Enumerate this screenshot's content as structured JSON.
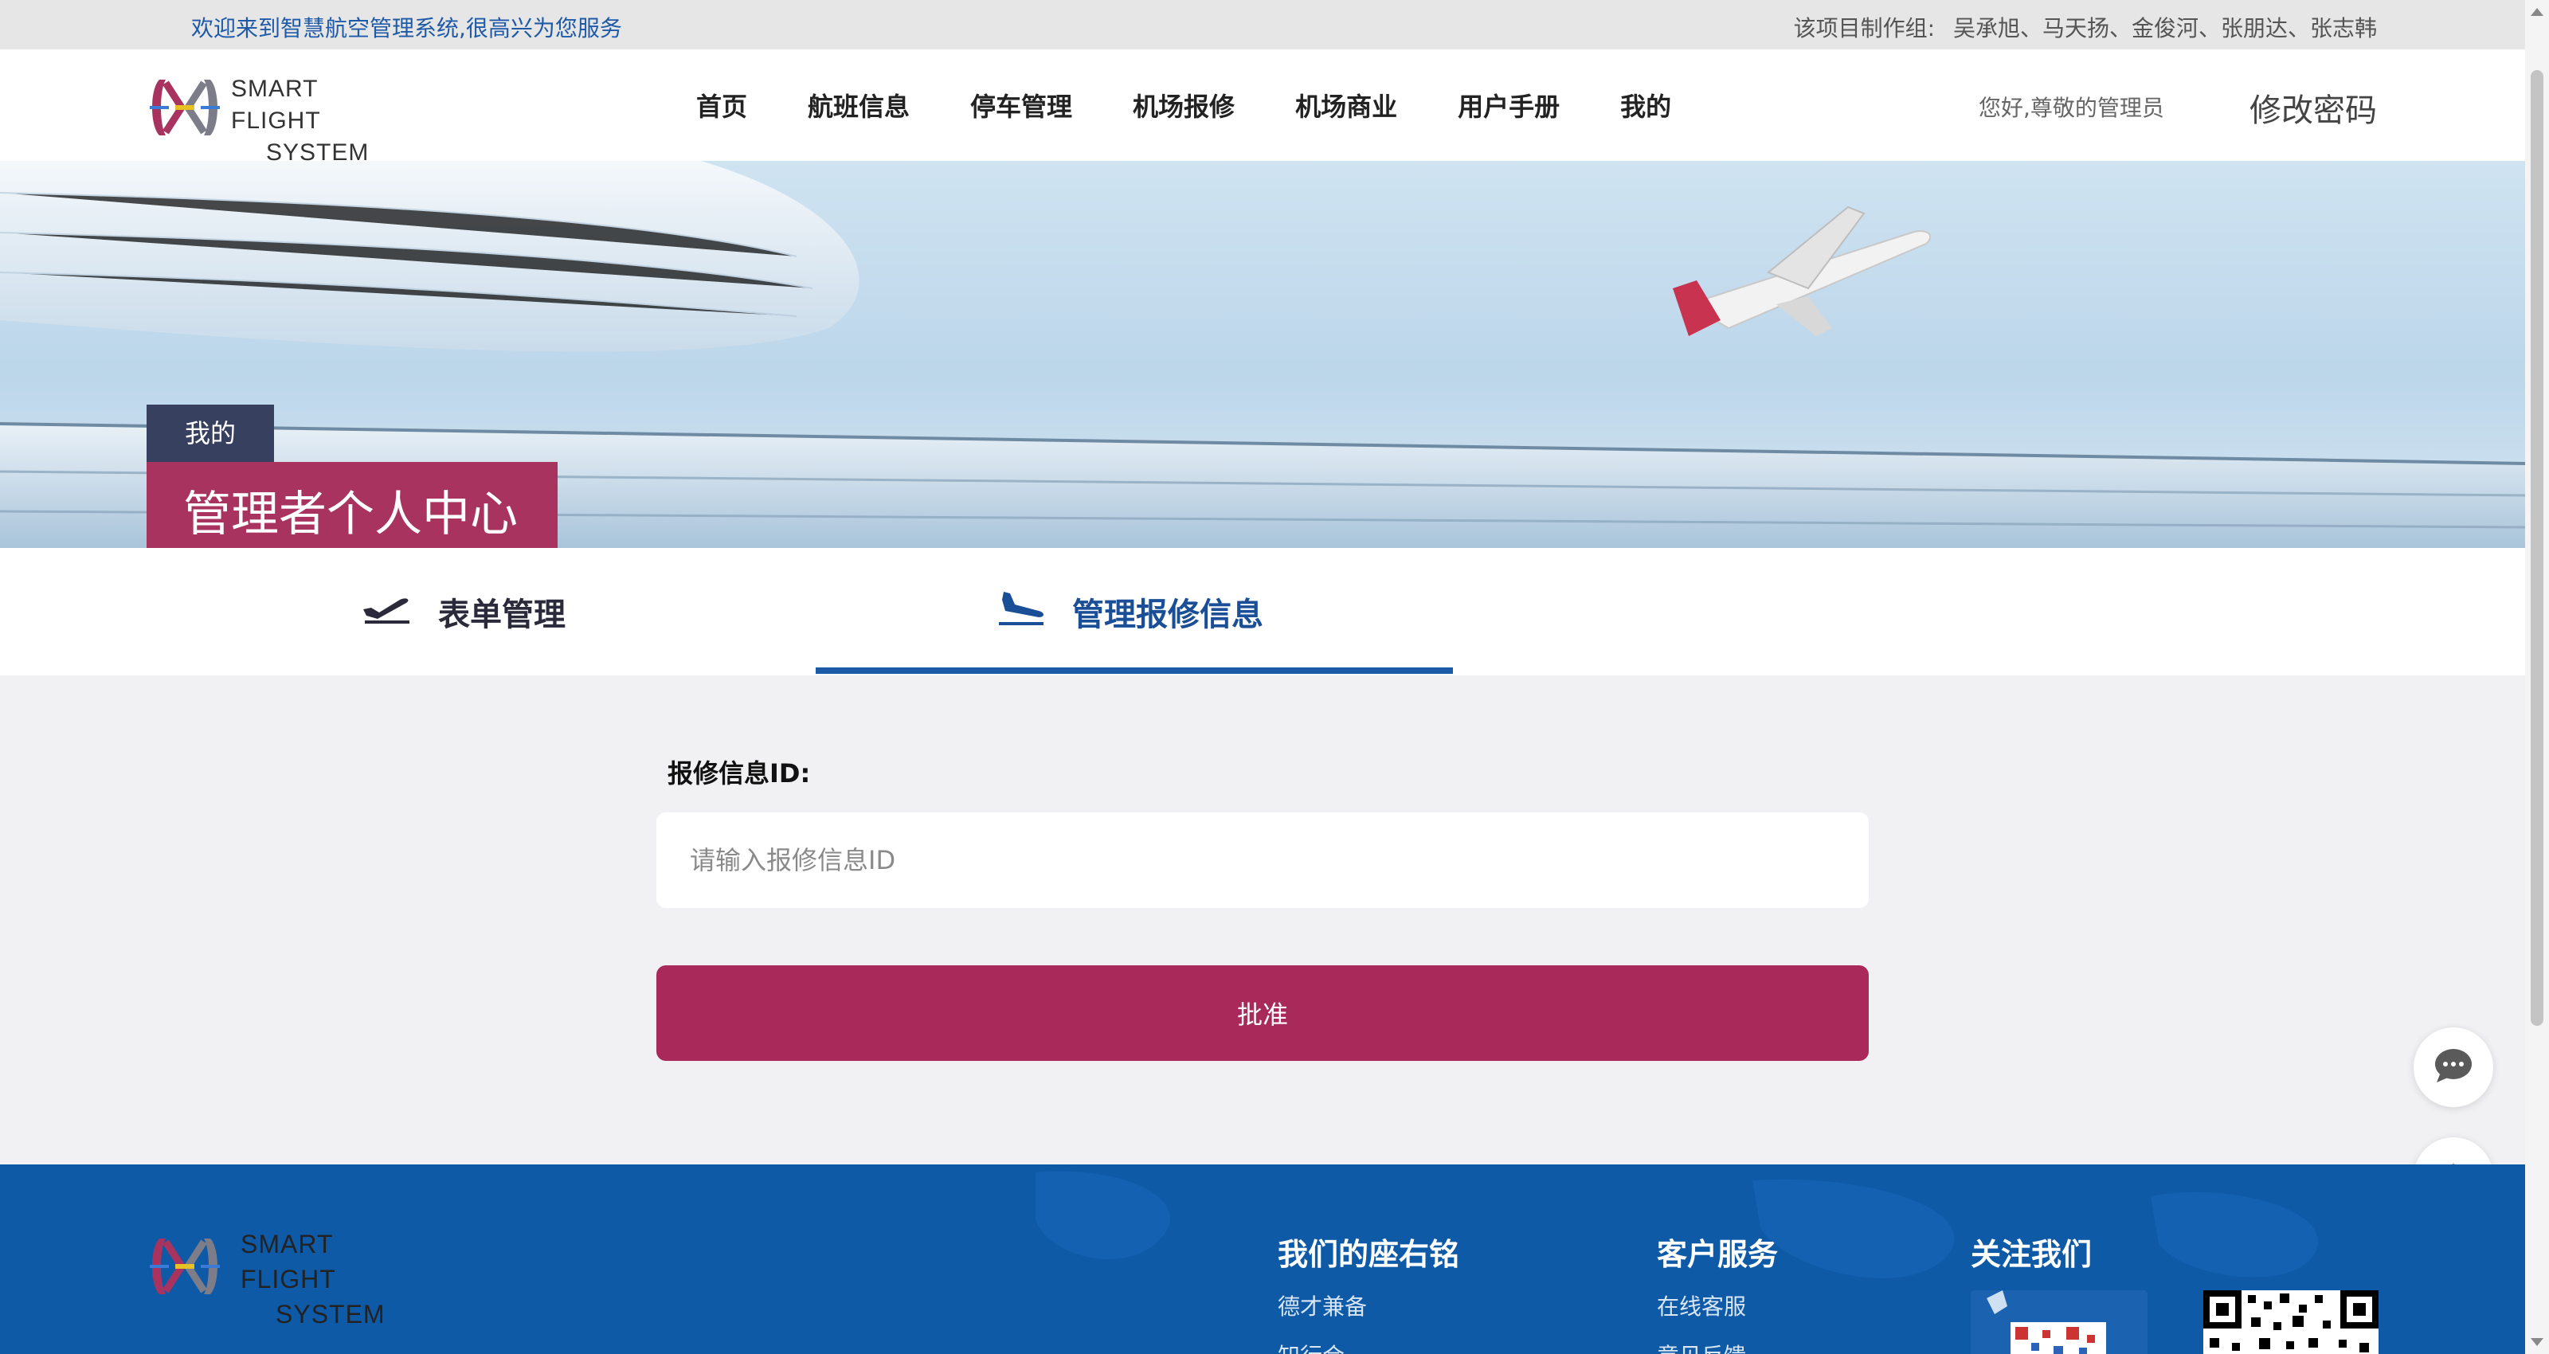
{
  "topbar": {
    "welcome": "欢迎来到智慧航空管理系统,很高兴为您服务",
    "credits_label": "该项目制作组:",
    "credits_names": "吴承旭、马天扬、金俊河、张朋达、张志韩"
  },
  "header": {
    "logo_line1": "SMART FLIGHT",
    "logo_line2": "SYSTEM",
    "nav": [
      "首页",
      "航班信息",
      "停车管理",
      "机场报修",
      "机场商业",
      "用户手册",
      "我的"
    ],
    "greeting": "您好,尊敬的管理员",
    "change_password": "修改密码"
  },
  "banner": {
    "breadcrumb": "我的",
    "title": "管理者个人中心"
  },
  "tabs": [
    {
      "label": "表单管理",
      "icon": "plane-takeoff-icon",
      "active": false
    },
    {
      "label": "管理报修信息",
      "icon": "plane-landing-icon",
      "active": true
    }
  ],
  "form": {
    "label": "报修信息ID:",
    "placeholder": "请输入报修信息ID",
    "value": "",
    "submit_label": "批准"
  },
  "footer": {
    "logo_line1": "SMART FLIGHT",
    "logo_line2": "SYSTEM",
    "col1_title": "我们的座右铭",
    "col1_items": [
      "德才兼备",
      "知行合一"
    ],
    "col2_title": "客户服务",
    "col2_items": [
      "在线客服",
      "意见反馈"
    ],
    "col3_title": "关注我们"
  },
  "colors": {
    "brand_primary": "#a8295a",
    "brand_blue": "#1a5aa6",
    "footer_blue": "#0e5aa7",
    "breadcrumb_bg": "#37405e"
  }
}
